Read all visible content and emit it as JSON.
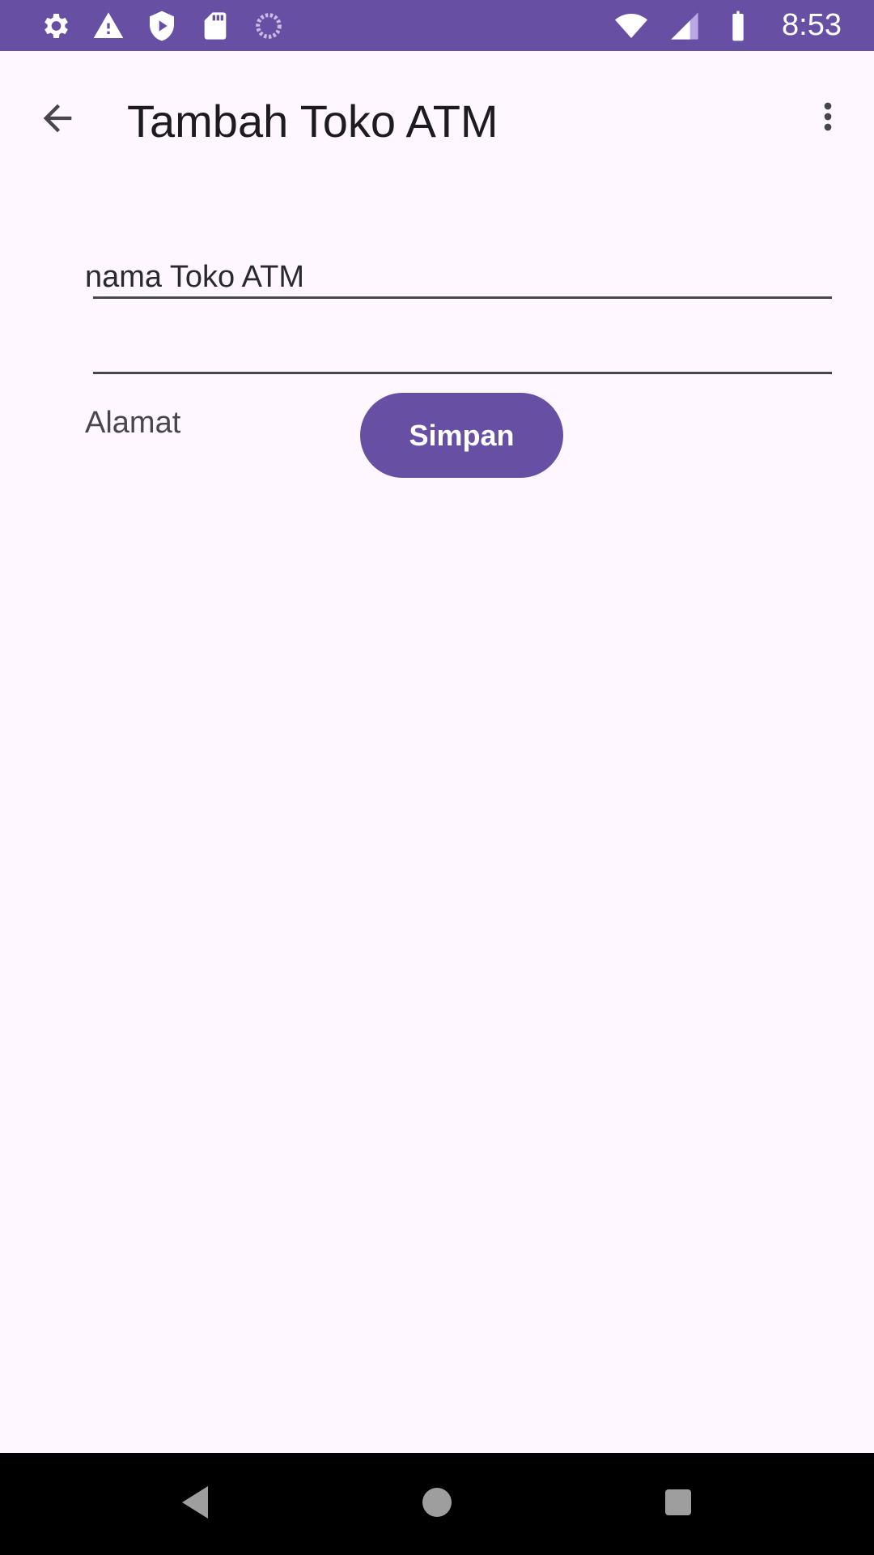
{
  "status_bar": {
    "time": "8:53",
    "left_icons": [
      "settings-icon",
      "warning-icon",
      "play-protect-icon",
      "sd-card-icon",
      "loading-icon"
    ],
    "right_icons": [
      "wifi-icon",
      "signal-icon",
      "battery-icon"
    ],
    "background": "#6750A4"
  },
  "app_bar": {
    "title": "Tambah Toko ATM",
    "back_icon": "arrow-back-icon",
    "overflow_icon": "more-vert-icon"
  },
  "form": {
    "name_field_value": "nama Toko ATM",
    "address_field_value": "",
    "address_label": "Alamat",
    "save_label": "Simpan"
  },
  "nav_bar": {
    "back_icon": "nav-back-icon",
    "home_icon": "nav-home-icon",
    "recents_icon": "nav-recents-icon"
  },
  "colors": {
    "accent": "#6750A4",
    "background": "#FEF7FF",
    "text": "#1D1B20"
  }
}
